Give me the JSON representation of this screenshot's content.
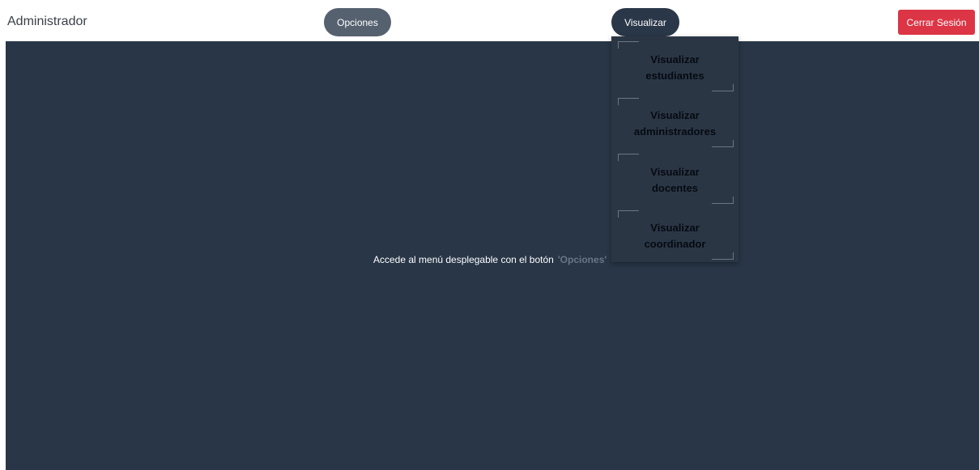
{
  "header": {
    "brand": "Administrador",
    "options_label": "Opciones",
    "visualizar_label": "Visualizar",
    "logout_label": "Cerrar Sesión"
  },
  "main": {
    "hint_text": "Accede al menú desplegable con el botón",
    "hint_highlight": "'Opciones'"
  },
  "dropdown": {
    "items": [
      {
        "label": "Visualizar estudiantes"
      },
      {
        "label": "Visualizar administradores"
      },
      {
        "label": "Visualizar docentes"
      },
      {
        "label": "Visualizar coordinador"
      }
    ]
  },
  "colors": {
    "main_background": "#283647",
    "options_button": "#566170",
    "visualizar_button": "#2a3748",
    "logout_button": "#dc3545"
  }
}
